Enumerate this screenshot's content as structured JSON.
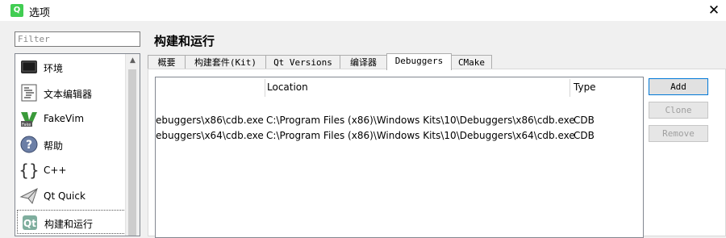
{
  "window": {
    "title": "选项",
    "app_icon_letter": "Q"
  },
  "filter": {
    "placeholder": "Filter",
    "value": ""
  },
  "sidebar": {
    "items": [
      {
        "label": "环境",
        "icon": "monitor-icon"
      },
      {
        "label": "文本编辑器",
        "icon": "text-editor-icon"
      },
      {
        "label": "FakeVim",
        "icon": "fakevim-icon"
      },
      {
        "label": "帮助",
        "icon": "help-icon"
      },
      {
        "label": "C++",
        "icon": "braces-icon"
      },
      {
        "label": "Qt Quick",
        "icon": "paper-plane-icon"
      },
      {
        "label": "构建和运行",
        "icon": "qt-build-icon",
        "selected": true
      }
    ]
  },
  "page_title": "构建和运行",
  "tabs": [
    {
      "label": "概要"
    },
    {
      "label": "构建套件(Kit)"
    },
    {
      "label": "Qt Versions"
    },
    {
      "label": "编译器"
    },
    {
      "label": "Debuggers",
      "active": true
    },
    {
      "label": "CMake"
    }
  ],
  "debuggers": {
    "columns": {
      "name": "",
      "location": "Location",
      "type": "Type"
    },
    "rows": [
      {
        "name": "ebuggers\\x86\\cdb.exe",
        "location": "C:\\Program Files (x86)\\Windows Kits\\10\\Debuggers\\x86\\cdb.exe",
        "type": "CDB"
      },
      {
        "name": "ebuggers\\x64\\cdb.exe",
        "location": "C:\\Program Files (x86)\\Windows Kits\\10\\Debuggers\\x64\\cdb.exe",
        "type": "CDB"
      }
    ]
  },
  "buttons": {
    "add": "Add",
    "clone": "Clone",
    "remove": "Remove"
  }
}
